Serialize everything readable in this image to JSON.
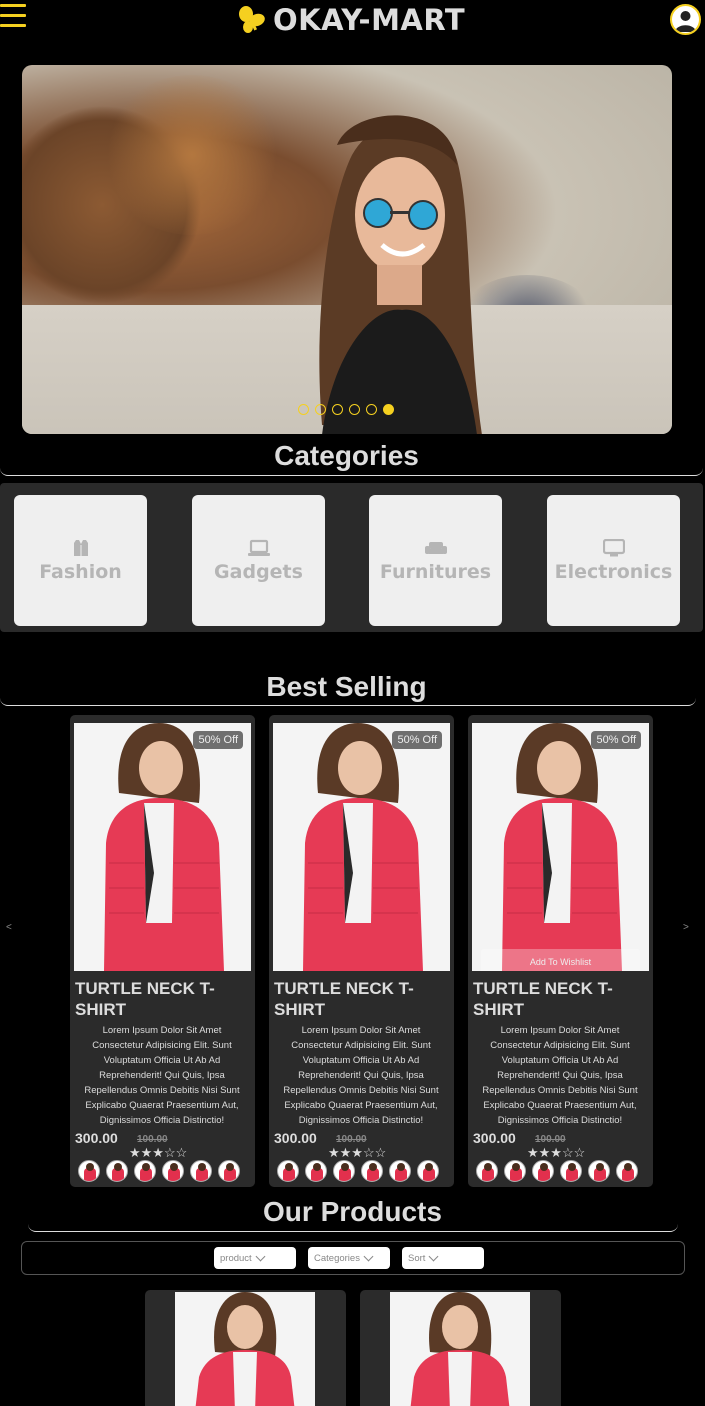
{
  "header": {
    "brand": "OKAY-MART",
    "accent": "#f5d020",
    "menu_icon": "hamburger-icon",
    "logo_icon": "butterfly-icon",
    "user_icon": "user-circle-icon"
  },
  "hero": {
    "slides_count": 6,
    "active_slide": 6
  },
  "categories": {
    "title": "Categories",
    "items": [
      {
        "label": "Fashion",
        "icon": "vest-icon"
      },
      {
        "label": "Gadgets",
        "icon": "laptop-icon"
      },
      {
        "label": "Furnitures",
        "icon": "couch-icon"
      },
      {
        "label": "Electronics",
        "icon": "tv-icon"
      }
    ]
  },
  "best_selling": {
    "title": "Best Selling",
    "prev_label": "<",
    "next_label": ">",
    "products": [
      {
        "badge": "50% Off",
        "name": "TURTLE NECK T-SHIRT",
        "description": "Lorem Ipsum Dolor Sit Amet Consectetur Adipisicing Elit. Sunt Voluptatum Officia Ut Ab Ad Reprehenderit! Qui Quis, Ipsa Repellendus Omnis Debitis Nisi Sunt Explicabo Quaerat Praesentium Aut, Dignissimos Officia Distinctio!",
        "price": "300.00",
        "old_price": "100.00",
        "rating": 3,
        "stars": "★★★☆☆",
        "wishlist_label": ""
      },
      {
        "badge": "50% Off",
        "name": "TURTLE NECK T-SHIRT",
        "description": "Lorem Ipsum Dolor Sit Amet Consectetur Adipisicing Elit. Sunt Voluptatum Officia Ut Ab Ad Reprehenderit! Qui Quis, Ipsa Repellendus Omnis Debitis Nisi Sunt Explicabo Quaerat Praesentium Aut, Dignissimos Officia Distinctio!",
        "price": "300.00",
        "old_price": "100.00",
        "rating": 3,
        "stars": "★★★☆☆",
        "wishlist_label": ""
      },
      {
        "badge": "50% Off",
        "name": "TURTLE NECK T-SHIRT",
        "description": "Lorem Ipsum Dolor Sit Amet Consectetur Adipisicing Elit. Sunt Voluptatum Officia Ut Ab Ad Reprehenderit! Qui Quis, Ipsa Repellendus Omnis Debitis Nisi Sunt Explicabo Quaerat Praesentium Aut, Dignissimos Officia Distinctio!",
        "price": "300.00",
        "old_price": "100.00",
        "rating": 3,
        "stars": "★★★☆☆",
        "wishlist_label": "Add To Wishlist"
      }
    ]
  },
  "our_products": {
    "title": "Our Products",
    "filters": [
      {
        "label": "product"
      },
      {
        "label": "Categories"
      },
      {
        "label": "Sort"
      }
    ]
  }
}
